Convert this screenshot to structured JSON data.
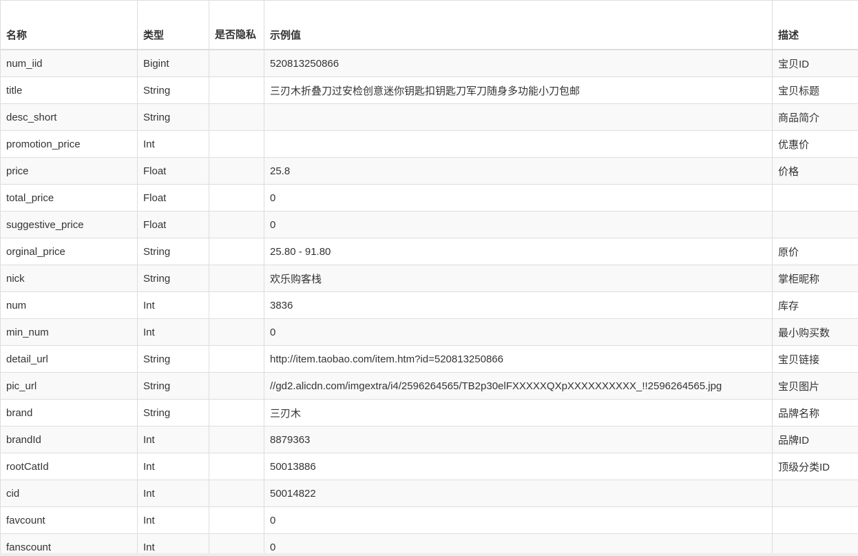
{
  "table": {
    "headers": [
      "名称",
      "类型",
      "是否隐私",
      "示例值",
      "描述"
    ],
    "rows": [
      [
        "num_iid",
        "Bigint",
        "",
        "520813250866",
        "宝贝ID"
      ],
      [
        "title",
        "String",
        "",
        "三刃木折叠刀过安检创意迷你钥匙扣钥匙刀军刀随身多功能小刀包邮",
        "宝贝标题"
      ],
      [
        "desc_short",
        "String",
        "",
        "",
        "商品简介"
      ],
      [
        "promotion_price",
        "Int",
        "",
        "",
        "优惠价"
      ],
      [
        "price",
        "Float",
        "",
        "25.8",
        "价格"
      ],
      [
        "total_price",
        "Float",
        "",
        "0",
        ""
      ],
      [
        "suggestive_price",
        "Float",
        "",
        "0",
        ""
      ],
      [
        "orginal_price",
        "String",
        "",
        "25.80 - 91.80",
        "原价"
      ],
      [
        "nick",
        "String",
        "",
        "欢乐购客栈",
        "掌柜昵称"
      ],
      [
        "num",
        "Int",
        "",
        "3836",
        "库存"
      ],
      [
        "min_num",
        "Int",
        "",
        "0",
        "最小购买数"
      ],
      [
        "detail_url",
        "String",
        "",
        "http://item.taobao.com/item.htm?id=520813250866",
        "宝贝链接"
      ],
      [
        "pic_url",
        "String",
        "",
        "//gd2.alicdn.com/imgextra/i4/2596264565/TB2p30elFXXXXXQXpXXXXXXXXXX_!!2596264565.jpg",
        "宝贝图片"
      ],
      [
        "brand",
        "String",
        "",
        "三刃木",
        "品牌名称"
      ],
      [
        "brandId",
        "Int",
        "",
        "8879363",
        "品牌ID"
      ],
      [
        "rootCatId",
        "Int",
        "",
        "50013886",
        "顶级分类ID"
      ],
      [
        "cid",
        "Int",
        "",
        "50014822",
        ""
      ],
      [
        "favcount",
        "Int",
        "",
        "0",
        ""
      ],
      [
        "fanscount",
        "Int",
        "",
        "0",
        ""
      ]
    ]
  }
}
